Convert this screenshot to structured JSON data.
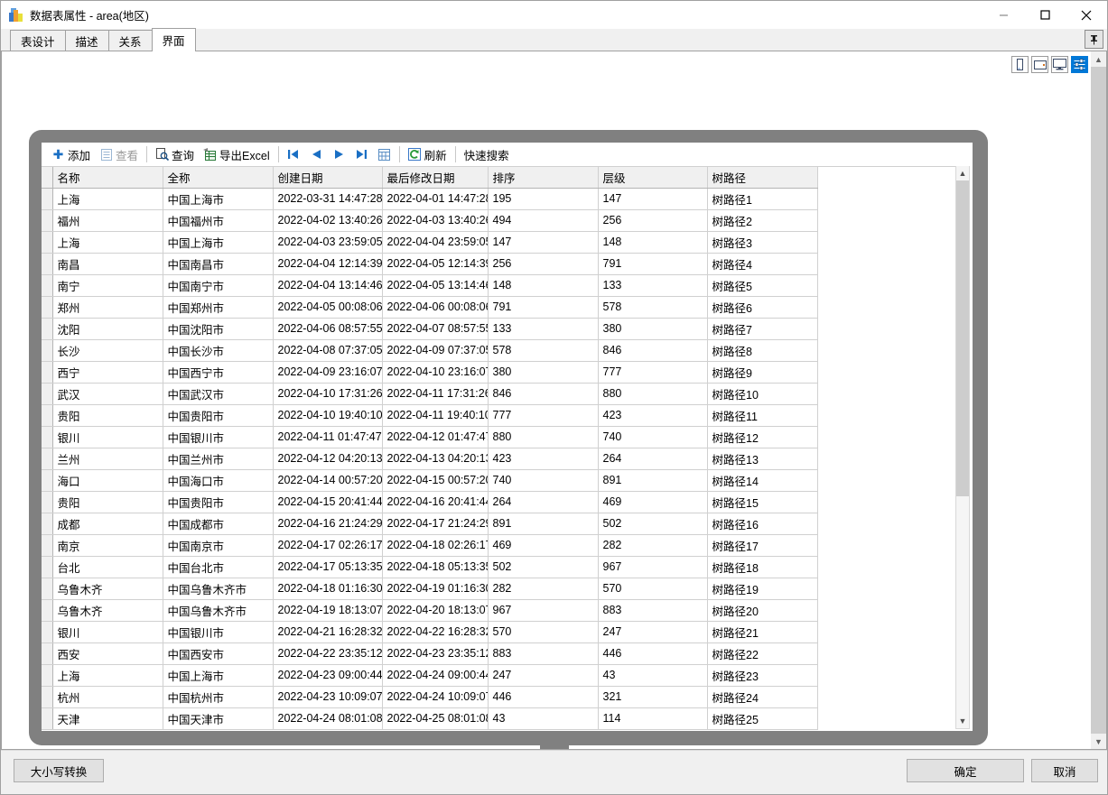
{
  "window": {
    "title": "数据表属性 - area(地区)",
    "icon": "table-properties-icon",
    "minimize": "—",
    "maximize": "□",
    "close": "✕"
  },
  "tabs": [
    {
      "label": "表设计",
      "selected": false
    },
    {
      "label": "描述",
      "selected": false
    },
    {
      "label": "关系",
      "selected": false
    },
    {
      "label": "界面",
      "selected": true
    }
  ],
  "pin_button": {
    "label": "⚲",
    "name": "pin-icon"
  },
  "view_modes": [
    {
      "name": "phone-view-button",
      "active": false
    },
    {
      "name": "tablet-view-button",
      "active": false
    },
    {
      "name": "desktop-view-button",
      "active": false
    },
    {
      "name": "settings-view-button",
      "active": true
    }
  ],
  "toolbar": {
    "add": "添加",
    "view": "查看",
    "query": "查询",
    "export_excel": "导出Excel",
    "nav_first": "⏮",
    "nav_prev": "◀",
    "nav_next": "▶",
    "nav_last": "⏭",
    "nav_page": "▦",
    "refresh": "刷新",
    "quick_search": "快速搜索"
  },
  "grid": {
    "columns": [
      "名称",
      "全称",
      "创建日期",
      "最后修改日期",
      "排序",
      "层级",
      "树路径"
    ],
    "rows": [
      [
        "上海",
        "中国上海市",
        "2022-03-31 14:47:28",
        "2022-04-01 14:47:28",
        "195",
        "147",
        "树路径1"
      ],
      [
        "福州",
        "中国福州市",
        "2022-04-02 13:40:26",
        "2022-04-03 13:40:26",
        "494",
        "256",
        "树路径2"
      ],
      [
        "上海",
        "中国上海市",
        "2022-04-03 23:59:05",
        "2022-04-04 23:59:05",
        "147",
        "148",
        "树路径3"
      ],
      [
        "南昌",
        "中国南昌市",
        "2022-04-04 12:14:39",
        "2022-04-05 12:14:39",
        "256",
        "791",
        "树路径4"
      ],
      [
        "南宁",
        "中国南宁市",
        "2022-04-04 13:14:46",
        "2022-04-05 13:14:46",
        "148",
        "133",
        "树路径5"
      ],
      [
        "郑州",
        "中国郑州市",
        "2022-04-05 00:08:06",
        "2022-04-06 00:08:06",
        "791",
        "578",
        "树路径6"
      ],
      [
        "沈阳",
        "中国沈阳市",
        "2022-04-06 08:57:55",
        "2022-04-07 08:57:55",
        "133",
        "380",
        "树路径7"
      ],
      [
        "长沙",
        "中国长沙市",
        "2022-04-08 07:37:05",
        "2022-04-09 07:37:05",
        "578",
        "846",
        "树路径8"
      ],
      [
        "西宁",
        "中国西宁市",
        "2022-04-09 23:16:07",
        "2022-04-10 23:16:07",
        "380",
        "777",
        "树路径9"
      ],
      [
        "武汉",
        "中国武汉市",
        "2022-04-10 17:31:26",
        "2022-04-11 17:31:26",
        "846",
        "880",
        "树路径10"
      ],
      [
        "贵阳",
        "中国贵阳市",
        "2022-04-10 19:40:10",
        "2022-04-11 19:40:10",
        "777",
        "423",
        "树路径11"
      ],
      [
        "银川",
        "中国银川市",
        "2022-04-11 01:47:47",
        "2022-04-12 01:47:47",
        "880",
        "740",
        "树路径12"
      ],
      [
        "兰州",
        "中国兰州市",
        "2022-04-12 04:20:13",
        "2022-04-13 04:20:13",
        "423",
        "264",
        "树路径13"
      ],
      [
        "海口",
        "中国海口市",
        "2022-04-14 00:57:20",
        "2022-04-15 00:57:20",
        "740",
        "891",
        "树路径14"
      ],
      [
        "贵阳",
        "中国贵阳市",
        "2022-04-15 20:41:44",
        "2022-04-16 20:41:44",
        "264",
        "469",
        "树路径15"
      ],
      [
        "成都",
        "中国成都市",
        "2022-04-16 21:24:29",
        "2022-04-17 21:24:29",
        "891",
        "502",
        "树路径16"
      ],
      [
        "南京",
        "中国南京市",
        "2022-04-17 02:26:17",
        "2022-04-18 02:26:17",
        "469",
        "282",
        "树路径17"
      ],
      [
        "台北",
        "中国台北市",
        "2022-04-17 05:13:35",
        "2022-04-18 05:13:35",
        "502",
        "967",
        "树路径18"
      ],
      [
        "乌鲁木齐",
        "中国乌鲁木齐市",
        "2022-04-18 01:16:30",
        "2022-04-19 01:16:30",
        "282",
        "570",
        "树路径19"
      ],
      [
        "乌鲁木齐",
        "中国乌鲁木齐市",
        "2022-04-19 18:13:07",
        "2022-04-20 18:13:07",
        "967",
        "883",
        "树路径20"
      ],
      [
        "银川",
        "中国银川市",
        "2022-04-21 16:28:32",
        "2022-04-22 16:28:32",
        "570",
        "247",
        "树路径21"
      ],
      [
        "西安",
        "中国西安市",
        "2022-04-22 23:35:12",
        "2022-04-23 23:35:12",
        "883",
        "446",
        "树路径22"
      ],
      [
        "上海",
        "中国上海市",
        "2022-04-23 09:00:44",
        "2022-04-24 09:00:44",
        "247",
        "43",
        "树路径23"
      ],
      [
        "杭州",
        "中国杭州市",
        "2022-04-23 10:09:07",
        "2022-04-24 10:09:07",
        "446",
        "321",
        "树路径24"
      ],
      [
        "天津",
        "中国天津市",
        "2022-04-24 08:01:08",
        "2022-04-25 08:01:08",
        "43",
        "114",
        "树路径25"
      ]
    ]
  },
  "footer": {
    "case_convert": "大小写转换",
    "ok": "确定",
    "cancel": "取消"
  },
  "colors": {
    "accent": "#0078d7",
    "toolbar_blue": "#1a6fc4",
    "monitor_gray": "#808080",
    "header_bg": "#f0f0f0"
  }
}
